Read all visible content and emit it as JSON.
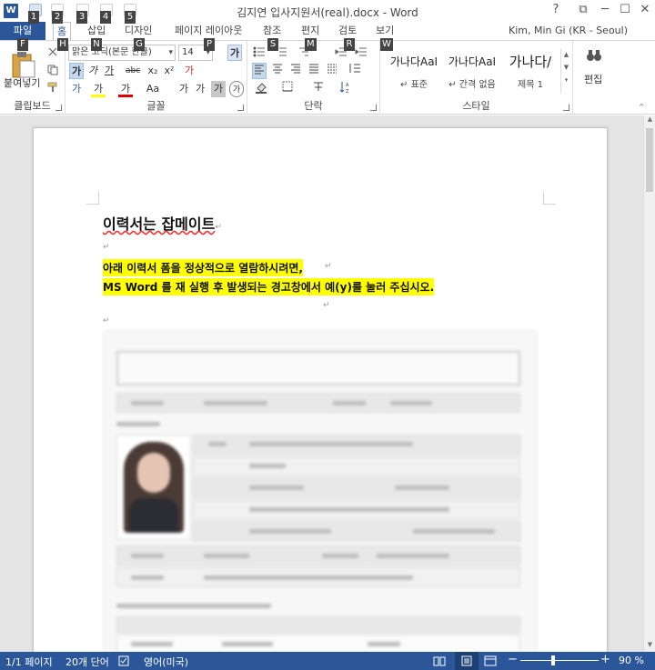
{
  "window": {
    "title": "김지연 입사지원서(real).docx - Word",
    "minimize": "─",
    "maximize": "☐",
    "close": "✕",
    "help": "?",
    "restore": "⧉"
  },
  "keytips": {
    "qat": [
      "1",
      "2",
      "3",
      "4",
      "5"
    ],
    "file": "F",
    "home": "H",
    "insert": "N",
    "design": "G",
    "layout": "P",
    "references": "S",
    "mailings": "M",
    "review": "R",
    "view": "W"
  },
  "tabs": {
    "file": "파일",
    "home": "홈",
    "insert": "삽입",
    "design": "디자인",
    "layout": "페이지 레이아웃",
    "references": "참조",
    "mailings": "편지",
    "review": "검토",
    "view": "보기"
  },
  "account": "Kim, Min Gi (KR - Seoul)",
  "ribbon": {
    "clipboard": {
      "paste": "붙여넣기",
      "label": "클립보드"
    },
    "font": {
      "font_name": "맑은 고딕(본문 한글)",
      "font_size": "14",
      "grow": "가",
      "shrink": "가",
      "clear": "가",
      "bold": "가",
      "italic": "가",
      "underline": "가",
      "strike": "abc",
      "sub": "x₂",
      "sup": "x²",
      "effects": "가",
      "highlight": "가",
      "color": "가",
      "case": "Aa",
      "phonetic": "가",
      "charborder": "가",
      "shade": "가",
      "enclose": "가",
      "label": "글꼴"
    },
    "paragraph": {
      "label": "단락"
    },
    "styles": {
      "items": [
        {
          "sample": "가나다AaI",
          "name": "↵ 표준"
        },
        {
          "sample": "가나다AaI",
          "name": "↵ 간격 없음"
        },
        {
          "sample": "가나다/",
          "name": "제목 1"
        }
      ],
      "label": "스타일"
    },
    "editing": {
      "label": "편집"
    }
  },
  "document": {
    "title": "이력서는 잡메이트",
    "line1": "아래 이력서 폼을 정상적으로 열람하시려면,",
    "line2": "MS Word 를 재 실행 후 발생되는 경고창에서 예(y)를 눌러 주십시오.",
    "mark": "↵"
  },
  "status": {
    "page": "1/1 페이지",
    "words": "20개 단어",
    "language": "영어(미국)",
    "zoom": "90 %"
  },
  "colors": {
    "accent": "#2b579a",
    "highlight": "#ffff00"
  }
}
